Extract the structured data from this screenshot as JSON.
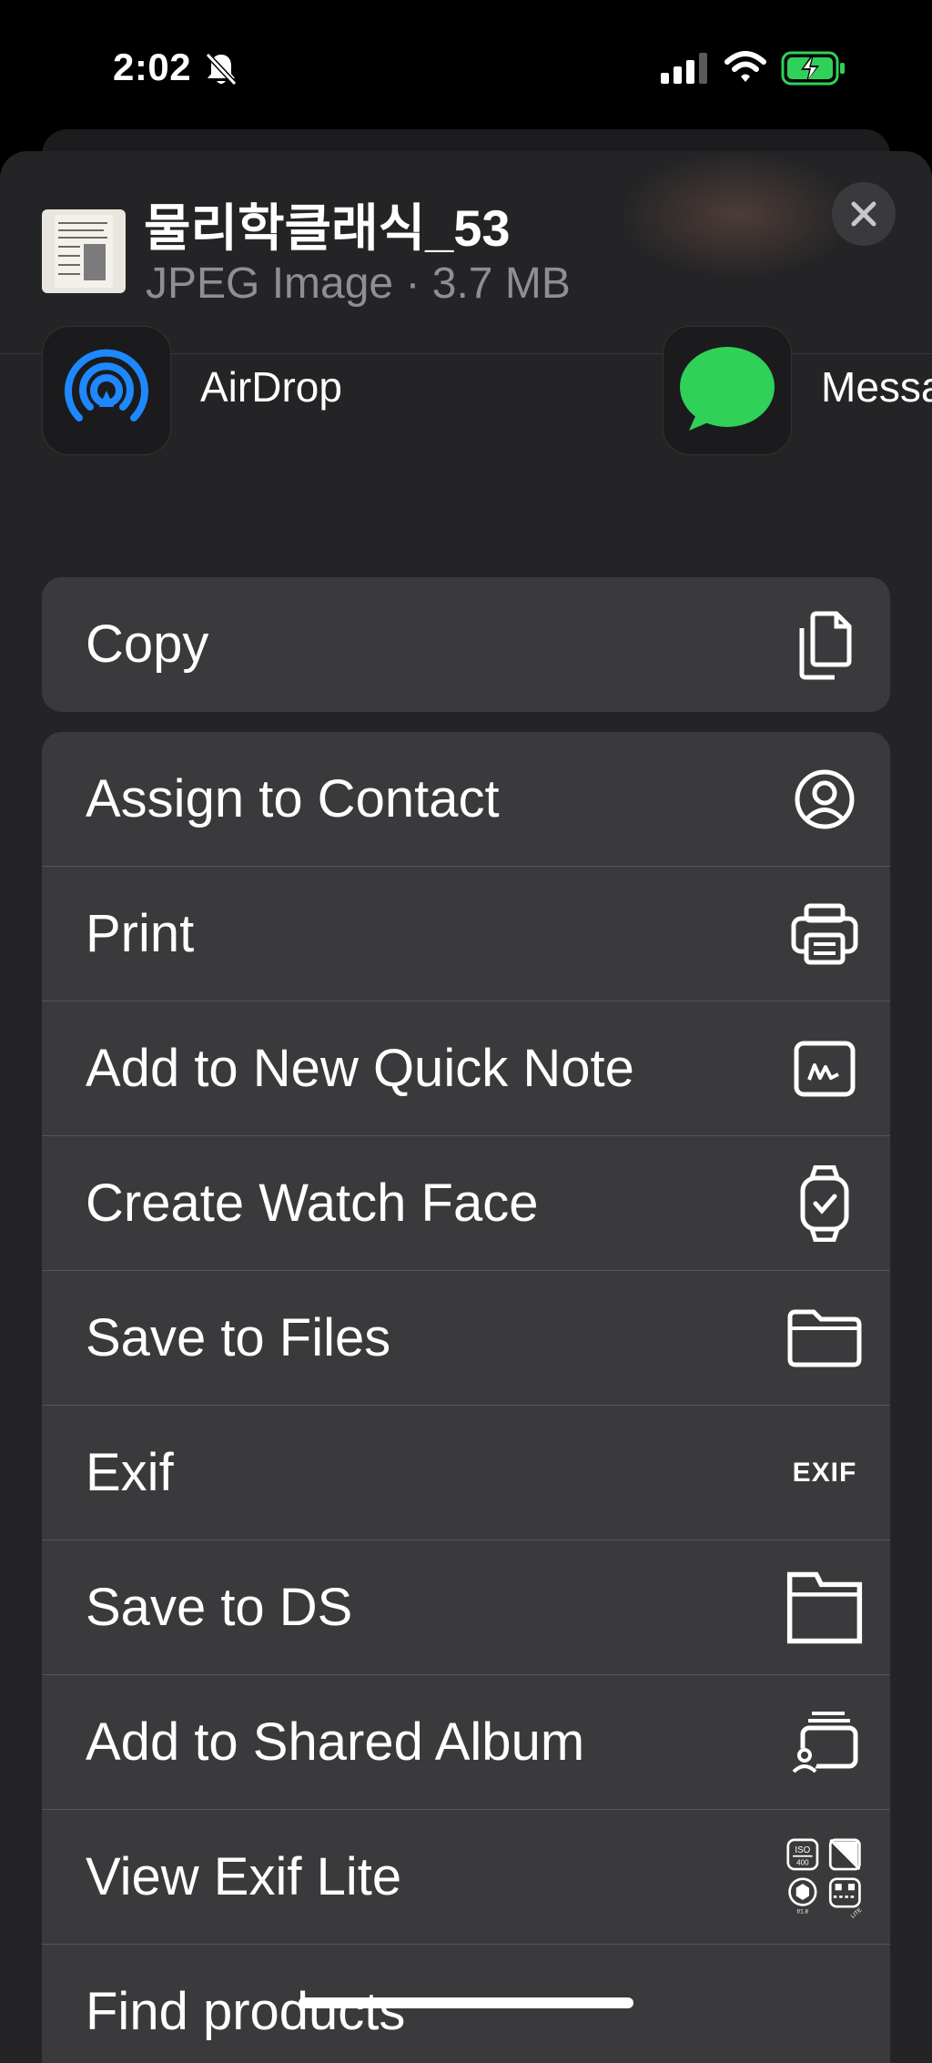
{
  "status_bar": {
    "time": "2:02",
    "battery_color": "#30d158"
  },
  "file": {
    "name": "물리학클래식_53",
    "meta": "JPEG Image · 3.7 MB"
  },
  "share_targets": [
    {
      "label": "AirDrop",
      "icon": "airdrop-icon"
    },
    {
      "label": "Messa",
      "icon": "messages-icon"
    }
  ],
  "actions": {
    "copy": {
      "label": "Copy",
      "icon": "copy-icon"
    },
    "items": [
      {
        "label": "Assign to Contact",
        "icon": "contact-icon"
      },
      {
        "label": "Print",
        "icon": "printer-icon"
      },
      {
        "label": "Add to New Quick Note",
        "icon": "quick-note-icon"
      },
      {
        "label": "Create Watch Face",
        "icon": "watch-icon"
      },
      {
        "label": "Save to Files",
        "icon": "folder-icon"
      },
      {
        "label": "Exif",
        "icon": "exif-icon",
        "icon_text": "EXIF"
      },
      {
        "label": "Save to DS",
        "icon": "ds-folder-icon"
      },
      {
        "label": "Add to Shared Album",
        "icon": "shared-album-icon"
      },
      {
        "label": "View Exif Lite",
        "icon": "exif-lite-icon"
      },
      {
        "label": "Find products",
        "icon": ""
      }
    ]
  },
  "colors": {
    "sheet": "#242426",
    "row": "#3a3a3c",
    "airdrop": "#1e88ff",
    "messages": "#30d158"
  }
}
